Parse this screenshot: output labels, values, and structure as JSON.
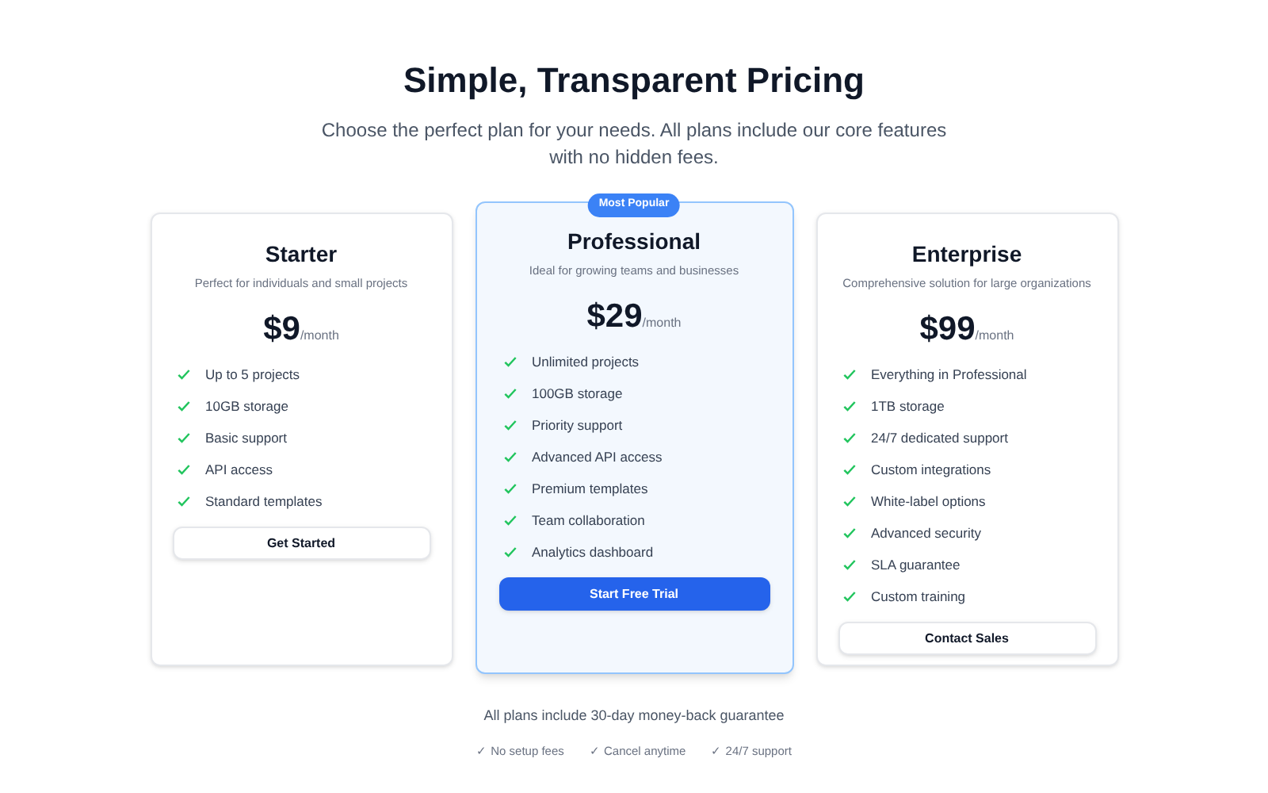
{
  "header": {
    "title": "Simple, Transparent Pricing",
    "subtitle": "Choose the perfect plan for your needs. All plans include our core features with no hidden fees."
  },
  "plans": [
    {
      "name": "Starter",
      "description": "Perfect for individuals and small projects",
      "price": "$9",
      "period": "/month",
      "featured": false,
      "features": [
        "Up to 5 projects",
        "10GB storage",
        "Basic support",
        "API access",
        "Standard templates"
      ],
      "button": "Get Started"
    },
    {
      "name": "Professional",
      "badge": "Most Popular",
      "description": "Ideal for growing teams and businesses",
      "price": "$29",
      "period": "/month",
      "featured": true,
      "features": [
        "Unlimited projects",
        "100GB storage",
        "Priority support",
        "Advanced API access",
        "Premium templates",
        "Team collaboration",
        "Analytics dashboard"
      ],
      "button": "Start Free Trial"
    },
    {
      "name": "Enterprise",
      "description": "Comprehensive solution for large organizations",
      "price": "$99",
      "period": "/month",
      "featured": false,
      "features": [
        "Everything in Professional",
        "1TB storage",
        "24/7 dedicated support",
        "Custom integrations",
        "White-label options",
        "Advanced security",
        "SLA guarantee",
        "Custom training"
      ],
      "button": "Contact Sales"
    }
  ],
  "footer": {
    "note": "All plans include 30-day money-back guarantee",
    "perks": [
      "✓ No setup fees",
      "✓ Cancel anytime",
      "✓ 24/7 support"
    ]
  }
}
